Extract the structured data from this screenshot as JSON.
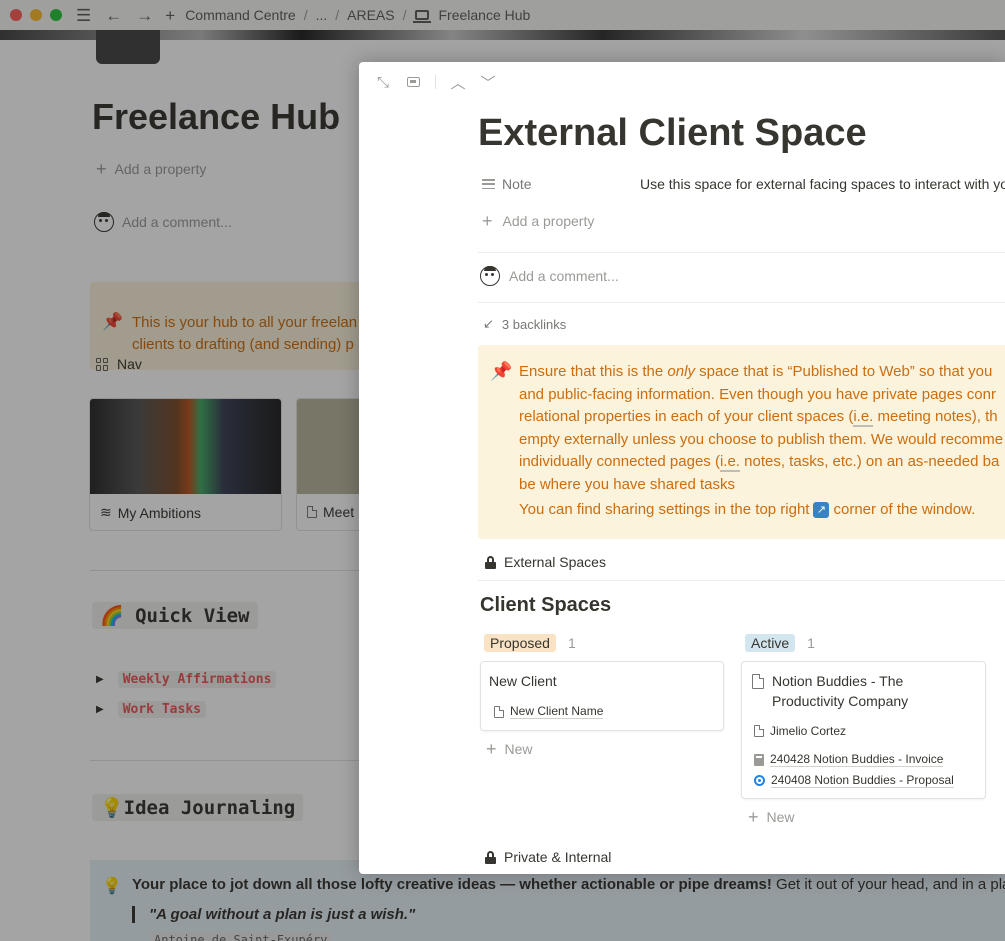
{
  "window": {
    "breadcrumbs": [
      "Command Centre",
      "...",
      "AREAS",
      "Freelance Hub"
    ]
  },
  "background": {
    "title": "Freelance Hub",
    "add_property": "Add a property",
    "add_comment": "Add a comment...",
    "callout_line1": "This is your hub to all your freelan",
    "callout_line2": "clients to drafting (and sending) p",
    "nav_label": "Nav",
    "cards": [
      {
        "label": "My Ambitions"
      },
      {
        "label": "Meet"
      }
    ],
    "quick_view_heading": "🌈 Quick View",
    "toggles": [
      "Weekly Affirmations",
      "Work Tasks"
    ],
    "idea_heading": "💡Idea Journaling",
    "idea_callout": {
      "bold": "Your place to jot down all those lofty creative ideas — whether actionable or pipe dreams!",
      "rest": " Get it out of your head, and in a plac",
      "quote": "\"A goal without a plan is just a wish.\"",
      "author": "Antoine de Saint-Exupéry"
    }
  },
  "modal": {
    "title": "External Client Space",
    "note_label": "Note",
    "note_value": "Use this space for external facing spaces to interact with you",
    "add_property": "Add a property",
    "add_comment": "Add a comment...",
    "backlinks": "3 backlinks",
    "callout": {
      "l1_before": "Ensure that this is the ",
      "l1_em": "only",
      "l1_after": " space that is “Published to Web” so that you",
      "l2": "and public-facing information. Even though you have private pages conr",
      "l3_before": "relational properties in each of your client spaces (",
      "l3_ie": "i.e.",
      "l3_after": " meeting notes), th",
      "l4": "empty externally unless you choose to publish them. We would recomme",
      "l5_before": "individually connected pages (",
      "l5_ie": "i.e.",
      "l5_after": " notes, tasks, etc.) on an as-needed ba",
      "l6": "be where you have shared tasks",
      "l7_before": "You can find sharing settings in the top right",
      "l7_after": "corner of the window."
    },
    "external_spaces": "External Spaces",
    "client_spaces_heading": "Client Spaces",
    "columns": [
      {
        "status": "Proposed",
        "count": "1",
        "card": {
          "title": "New Client",
          "link": "New Client Name"
        },
        "new_label": "New"
      },
      {
        "status": "Active",
        "count": "1",
        "card": {
          "title_line1": "Notion Buddies - The",
          "title_line2": "Productivity Company",
          "person": "Jimelio Cortez",
          "invoice": "240428 Notion Buddies - Invoice",
          "proposal": "240408 Notion Buddies - Proposal"
        },
        "new_label": "New"
      }
    ],
    "private_internal": "Private & Internal"
  },
  "colors": {
    "callout_bg": "#fbf3db",
    "callout_text": "#cb6d10",
    "proposed_pill": "#fae3c4",
    "active_pill": "#d3e5ef"
  }
}
